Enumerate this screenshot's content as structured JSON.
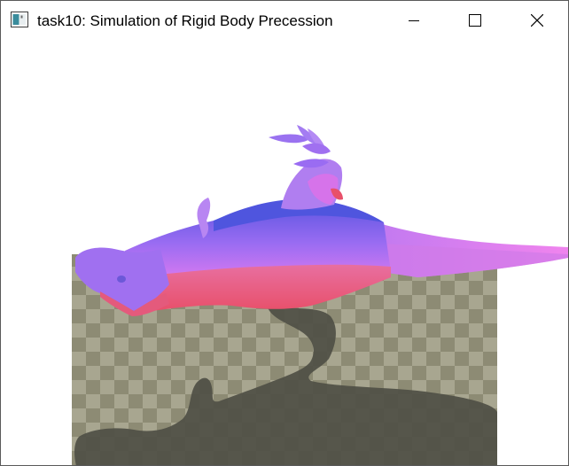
{
  "window": {
    "title": "task10: Simulation of Rigid Body Precession",
    "app_icon": "window-app-icon",
    "controls": [
      {
        "name": "minimize",
        "icon": "minimize-icon"
      },
      {
        "name": "maximize",
        "icon": "maximize-icon"
      },
      {
        "name": "close",
        "icon": "close-icon"
      }
    ]
  },
  "scene": {
    "background_color": "#ffffff",
    "floor": {
      "color_a": "#8d8b74",
      "color_b": "#a8a690",
      "pattern": "checkerboard"
    },
    "shadow_color": "#4f4f45",
    "model": {
      "name": "dinosaur mesh",
      "colors": {
        "violet": "#9a6cf2",
        "blue": "#5a55e0",
        "pink": "#e27cf0",
        "red": "#e8506a"
      }
    }
  }
}
